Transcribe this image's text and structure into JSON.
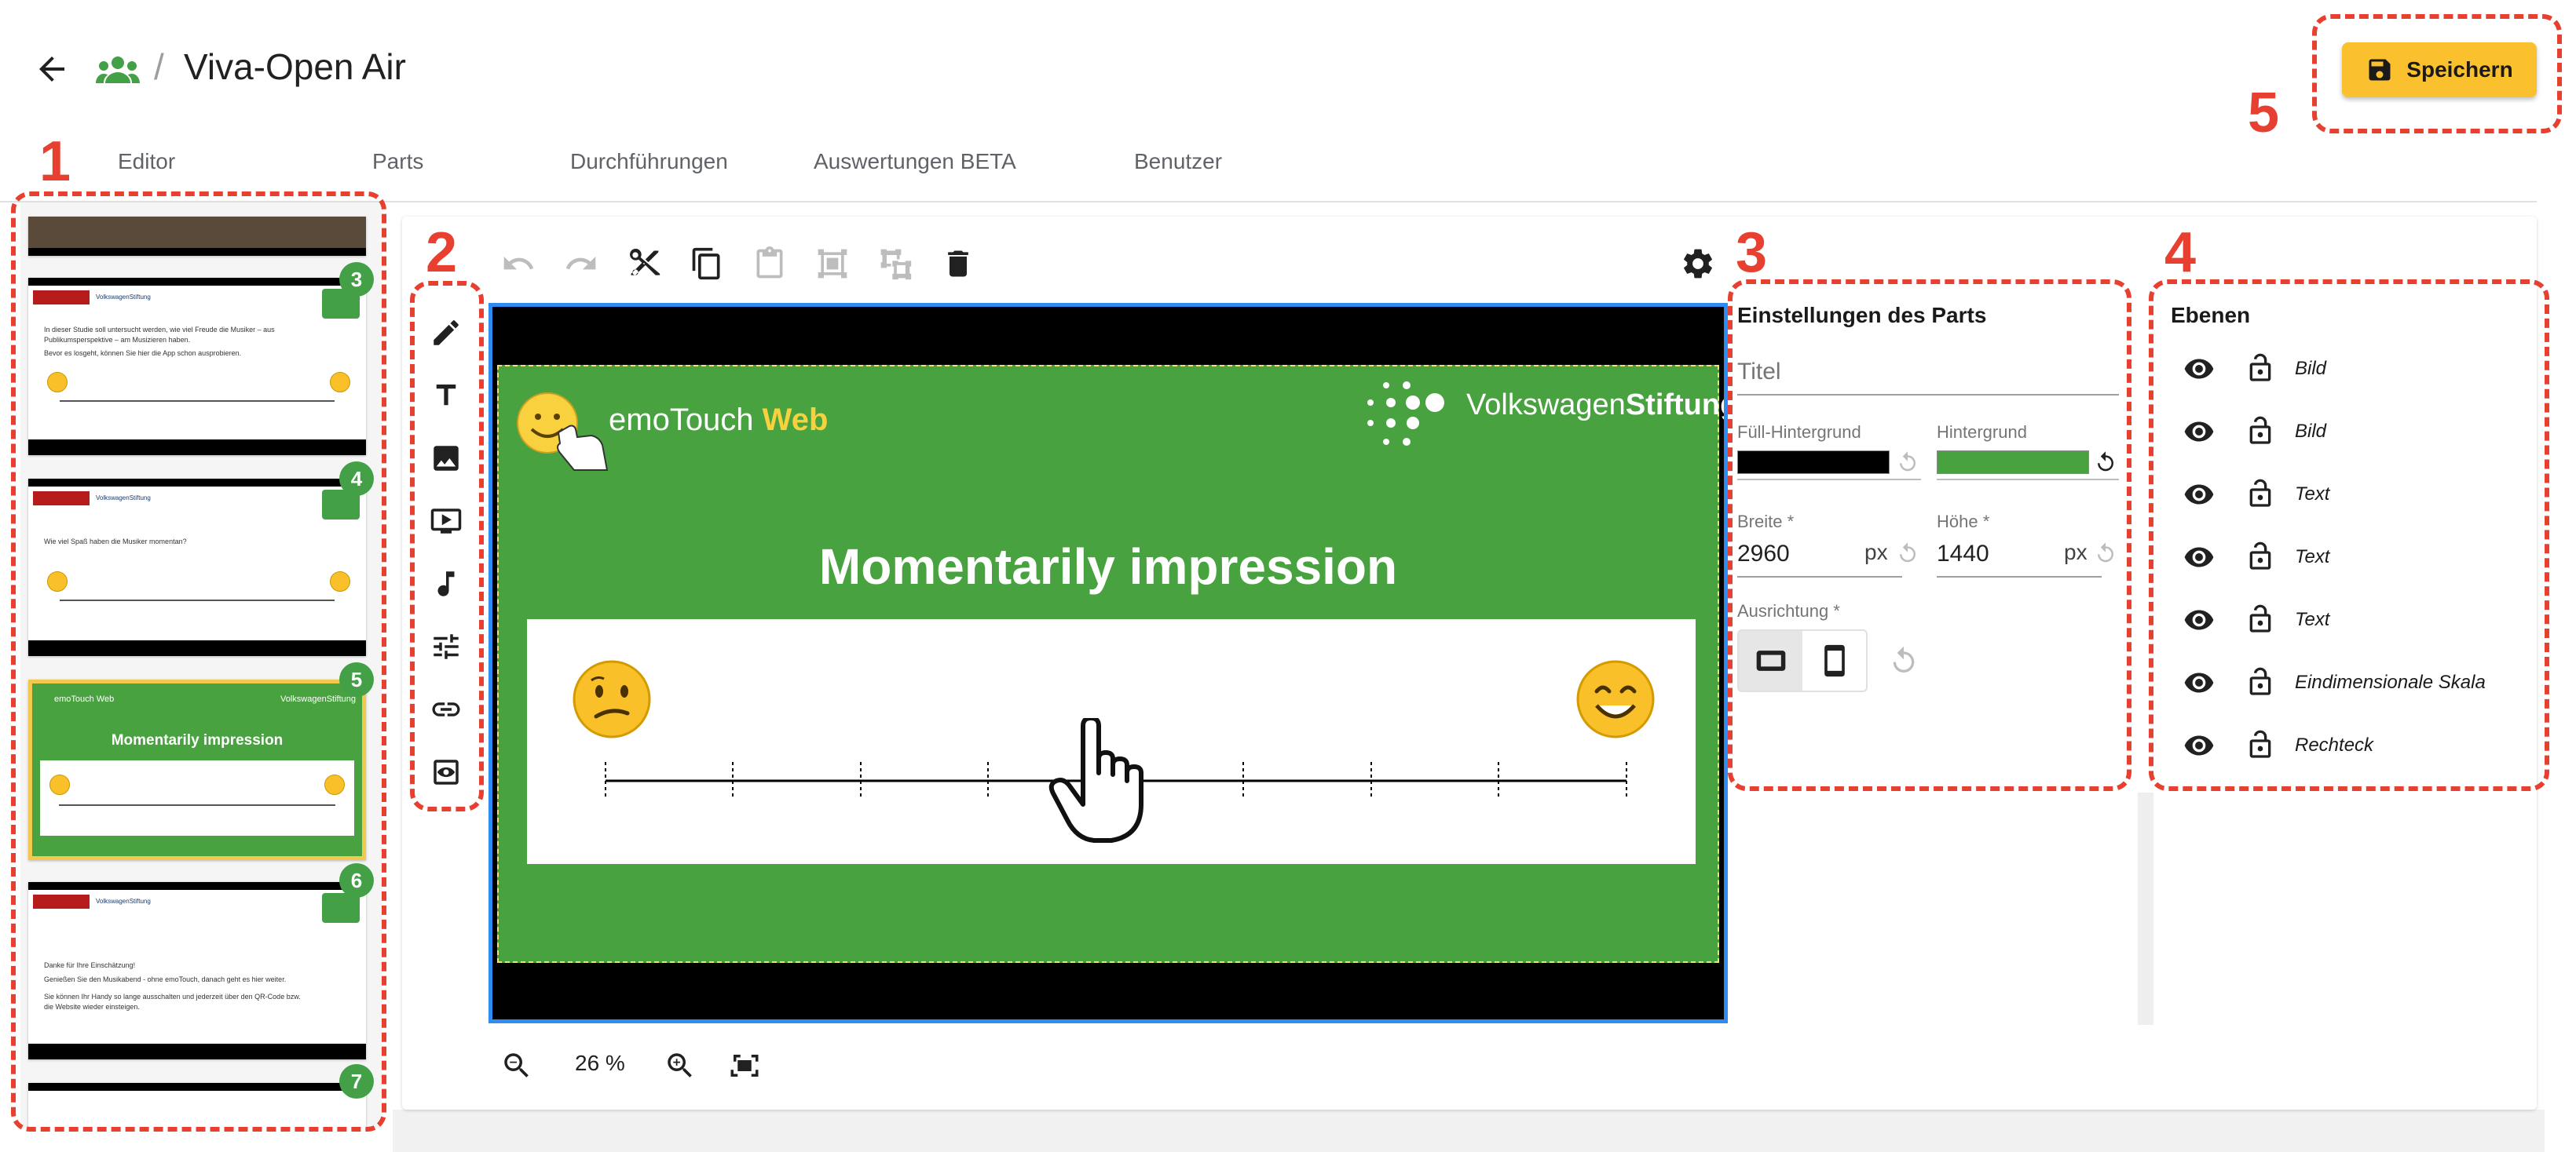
{
  "header": {
    "title": "Viva-Open Air",
    "separator": "/",
    "back_icon": "arrow-left-icon",
    "group_icon": "group-icon",
    "save_label": "Speichern",
    "save_icon": "floppy-disk-icon",
    "save_color": "#fbc02d"
  },
  "tabs": [
    {
      "label": "Editor"
    },
    {
      "label": "Parts"
    },
    {
      "label": "Durchführungen"
    },
    {
      "label": "Auswertungen BETA"
    },
    {
      "label": "Benutzer"
    }
  ],
  "annotations": [
    "1",
    "2",
    "3",
    "4",
    "5"
  ],
  "annotation_color": "#e84030",
  "slides": [
    {
      "number": "3",
      "text_lines": [
        "In dieser Studie soll untersucht werden, wie viel Freude die Musiker – aus Publikumsperspektive – am Musizieren haben.",
        "Bevor es losgeht, können Sie hier die App schon ausprobieren."
      ]
    },
    {
      "number": "4",
      "text_lines": [
        "Wie viel Spaß haben die Musiker momentan?"
      ]
    },
    {
      "number": "5",
      "title": "Momentarily impression",
      "brand_left": "emoTouch Web",
      "brand_right": "VolkswagenStiftung",
      "selected": true
    },
    {
      "number": "6",
      "text_lines": [
        "Danke für Ihre Einschätzung!",
        "Genießen Sie den Musikabend - ohne emoTouch, danach geht es hier weiter.",
        "Sie können Ihr Handy so lange ausschalten und jederzeit über den QR-Code bzw. die Website wieder einsteigen."
      ]
    },
    {
      "number": "7"
    }
  ],
  "slide_mini_brand": {
    "vw": "VolkswagenStiftung",
    "emo": "Web"
  },
  "toolbar": {
    "top_icons": [
      "undo-icon",
      "redo-icon",
      "cut-icon",
      "copy-icon",
      "paste-icon",
      "group-icon",
      "ungroup-icon",
      "delete-icon"
    ],
    "settings_icon": "gear-icon"
  },
  "side_tools": [
    "pencil-icon",
    "text-icon",
    "image-icon",
    "video-icon",
    "music-icon",
    "sliders-icon",
    "link-icon",
    "preview-icon"
  ],
  "canvas": {
    "title": "Momentarily impression",
    "brand_left_a": "emoTouch ",
    "brand_left_b": "Web",
    "brand_right_a": "Volkswagen",
    "brand_right_b": "Stiftung",
    "background_color": "#48a23f",
    "fill_color": "#000000"
  },
  "settings": {
    "heading": "Einstellungen des Parts",
    "title_placeholder": "Titel",
    "fill_bg_label": "Füll-Hintergrund",
    "bg_label": "Hintergrund",
    "width_label": "Breite *",
    "width_value": "2960",
    "height_label": "Höhe *",
    "height_value": "1440",
    "unit": "px",
    "orientation_label": "Ausrichtung *"
  },
  "layers": {
    "heading": "Ebenen",
    "items": [
      {
        "name": "Bild"
      },
      {
        "name": "Bild"
      },
      {
        "name": "Text"
      },
      {
        "name": "Text"
      },
      {
        "name": "Text"
      },
      {
        "name": "Eindimensionale Skala"
      },
      {
        "name": "Rechteck"
      }
    ]
  },
  "zoom": {
    "value": "26 %"
  }
}
